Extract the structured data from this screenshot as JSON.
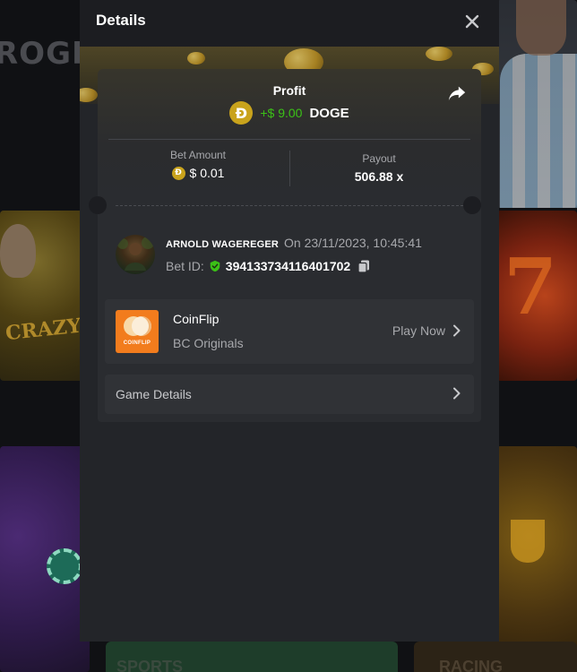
{
  "background": {
    "banner_text": "ROGR",
    "bottom_left_word": "SPORTS",
    "bottom_right_word": "RACING"
  },
  "modal": {
    "title": "Details",
    "profit": {
      "label": "Profit",
      "amount": "+$ 9.00",
      "currency": "DOGE",
      "coin_symbol": "Ð"
    },
    "bet_amount": {
      "label": "Bet Amount",
      "value": "$ 0.01",
      "coin_symbol": "Ð"
    },
    "payout": {
      "label": "Payout",
      "value": "506.88 x"
    },
    "user": {
      "name": "ARNOLD WAGEREGER",
      "time": "On 23/11/2023, 10:45:41",
      "bet_id_label": "Bet ID:",
      "bet_id": "394133734116401702"
    },
    "game": {
      "name": "CoinFlip",
      "provider": "BC Originals",
      "thumb_label": "COINFLIP",
      "play_label": "Play Now"
    },
    "game_details_label": "Game Details"
  },
  "colors": {
    "accent_green": "#3bc117",
    "coin_gold": "#c9a31c",
    "modal_bg": "#232529",
    "card_bg": "#303236"
  },
  "icons": {
    "close": "close-icon",
    "share": "share-icon",
    "shield": "shield-check-icon",
    "copy": "copy-icon",
    "chevron": "chevron-right-icon"
  }
}
